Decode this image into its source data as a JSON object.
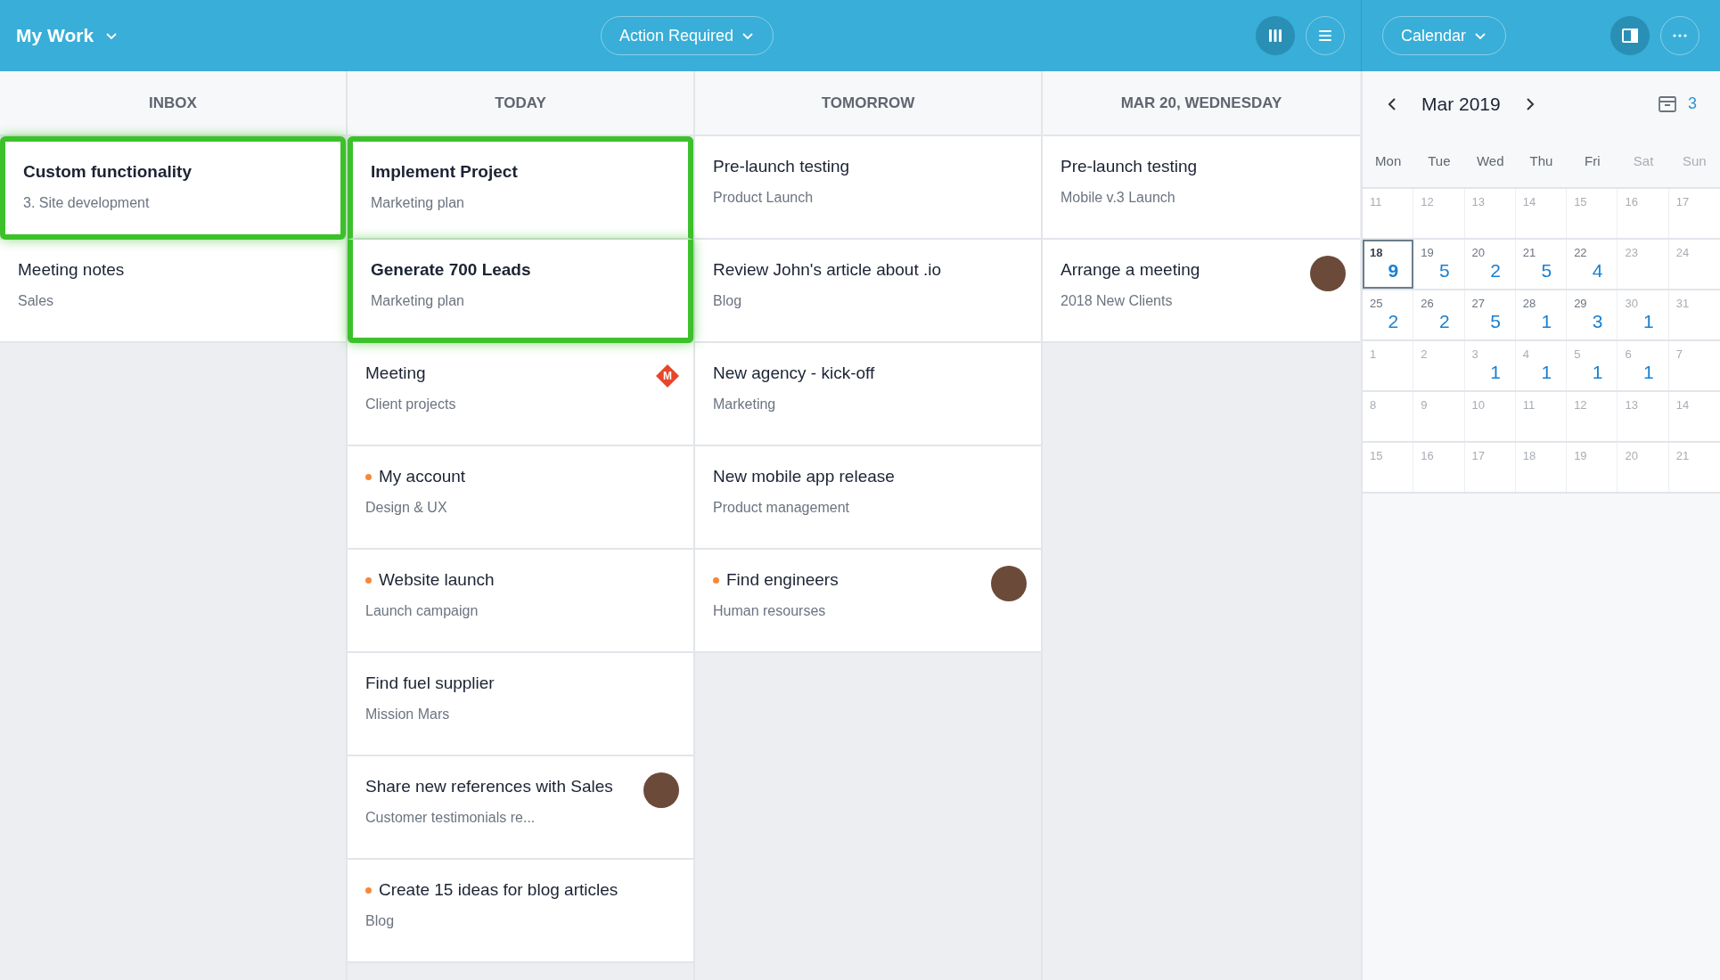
{
  "header": {
    "title": "My Work",
    "filter": "Action Required",
    "views": [
      {
        "kind": "board",
        "selected": true
      },
      {
        "kind": "list",
        "selected": false
      }
    ],
    "calendar_menu": "Calendar",
    "panel_selected": true
  },
  "columns": [
    {
      "title": "INBOX",
      "cards": [
        {
          "title": "Custom functionality",
          "subtitle": "3. Site development",
          "highlighted": true,
          "dot": false
        },
        {
          "title": "Meeting notes",
          "subtitle": "Sales",
          "highlighted": false,
          "dot": false
        }
      ]
    },
    {
      "title": "TODAY",
      "cards": [
        {
          "title": "Implement Project",
          "subtitle": "Marketing plan",
          "highlighted": true,
          "dot": false
        },
        {
          "title": "Generate 700 Leads",
          "subtitle": "Marketing plan",
          "highlighted": true,
          "dot": false
        },
        {
          "title": "Meeting",
          "subtitle": "Client projects",
          "highlighted": false,
          "dot": false,
          "badge": "M"
        },
        {
          "title": "My account",
          "subtitle": "Design & UX",
          "highlighted": false,
          "dot": true
        },
        {
          "title": "Website launch",
          "subtitle": "Launch campaign",
          "highlighted": false,
          "dot": true
        },
        {
          "title": "Find fuel supplier",
          "subtitle": "Mission Mars",
          "highlighted": false,
          "dot": false
        },
        {
          "title": "Share new references with Sales",
          "subtitle": "Customer testimonials re...",
          "highlighted": false,
          "dot": false,
          "avatar": true
        },
        {
          "title": "Create 15 ideas for blog articles",
          "subtitle": "Blog",
          "highlighted": false,
          "dot": true
        }
      ]
    },
    {
      "title": "TOMORROW",
      "cards": [
        {
          "title": "Pre-launch testing",
          "subtitle": "Product Launch",
          "highlighted": false,
          "dot": false
        },
        {
          "title": "Review John's article about .io",
          "subtitle": "Blog",
          "highlighted": false,
          "dot": false
        },
        {
          "title": "New agency - kick-off",
          "subtitle": "Marketing",
          "highlighted": false,
          "dot": false
        },
        {
          "title": "New mobile app release",
          "subtitle": "Product management",
          "highlighted": false,
          "dot": false
        },
        {
          "title": "Find engineers",
          "subtitle": "Human resourses",
          "highlighted": false,
          "dot": true,
          "avatar": true
        }
      ]
    },
    {
      "title": "MAR 20, WEDNESDAY",
      "cards": [
        {
          "title": "Pre-launch testing",
          "subtitle": "Mobile v.3 Launch",
          "highlighted": false,
          "dot": false
        },
        {
          "title": "Arrange a meeting",
          "subtitle": "2018 New Clients",
          "highlighted": false,
          "dot": false,
          "avatar": true
        }
      ]
    }
  ],
  "calendar": {
    "month": "Mar 2019",
    "archive_count": "3",
    "weekdays": [
      {
        "label": "Mon",
        "muted": false
      },
      {
        "label": "Tue",
        "muted": false
      },
      {
        "label": "Wed",
        "muted": false
      },
      {
        "label": "Thu",
        "muted": false
      },
      {
        "label": "Fri",
        "muted": false
      },
      {
        "label": "Sat",
        "muted": true
      },
      {
        "label": "Sun",
        "muted": true
      }
    ],
    "weeks": [
      [
        {
          "day": "11",
          "muted": true,
          "selected": false
        },
        {
          "day": "12",
          "muted": true,
          "selected": false
        },
        {
          "day": "13",
          "muted": true,
          "selected": false
        },
        {
          "day": "14",
          "muted": true,
          "selected": false
        },
        {
          "day": "15",
          "muted": true,
          "selected": false
        },
        {
          "day": "16",
          "muted": true,
          "selected": false
        },
        {
          "day": "17",
          "muted": true,
          "selected": false
        }
      ],
      [
        {
          "day": "18",
          "count": "9",
          "muted": false,
          "selected": true
        },
        {
          "day": "19",
          "count": "5",
          "muted": false,
          "selected": false
        },
        {
          "day": "20",
          "count": "2",
          "muted": false,
          "selected": false
        },
        {
          "day": "21",
          "count": "5",
          "muted": false,
          "selected": false
        },
        {
          "day": "22",
          "count": "4",
          "muted": false,
          "selected": false
        },
        {
          "day": "23",
          "muted": true,
          "selected": false
        },
        {
          "day": "24",
          "muted": true,
          "selected": false
        }
      ],
      [
        {
          "day": "25",
          "count": "2",
          "muted": false,
          "selected": false
        },
        {
          "day": "26",
          "count": "2",
          "muted": false,
          "selected": false
        },
        {
          "day": "27",
          "count": "5",
          "muted": false,
          "selected": false
        },
        {
          "day": "28",
          "count": "1",
          "muted": false,
          "selected": false
        },
        {
          "day": "29",
          "count": "3",
          "muted": false,
          "selected": false
        },
        {
          "day": "30",
          "count": "1",
          "muted": true,
          "selected": false
        },
        {
          "day": "31",
          "muted": true,
          "selected": false
        }
      ],
      [
        {
          "day": "1",
          "muted": true,
          "selected": false
        },
        {
          "day": "2",
          "muted": true,
          "selected": false
        },
        {
          "day": "3",
          "count": "1",
          "muted": true,
          "selected": false
        },
        {
          "day": "4",
          "count": "1",
          "muted": true,
          "selected": false
        },
        {
          "day": "5",
          "count": "1",
          "muted": true,
          "selected": false
        },
        {
          "day": "6",
          "count": "1",
          "muted": true,
          "selected": false
        },
        {
          "day": "7",
          "muted": true,
          "selected": false
        }
      ],
      [
        {
          "day": "8",
          "muted": true,
          "selected": false
        },
        {
          "day": "9",
          "muted": true,
          "selected": false
        },
        {
          "day": "10",
          "muted": true,
          "selected": false
        },
        {
          "day": "11",
          "muted": true,
          "selected": false
        },
        {
          "day": "12",
          "muted": true,
          "selected": false
        },
        {
          "day": "13",
          "muted": true,
          "selected": false
        },
        {
          "day": "14",
          "muted": true,
          "selected": false
        }
      ],
      [
        {
          "day": "15",
          "muted": true,
          "selected": false
        },
        {
          "day": "16",
          "muted": true,
          "selected": false
        },
        {
          "day": "17",
          "muted": true,
          "selected": false
        },
        {
          "day": "18",
          "muted": true,
          "selected": false
        },
        {
          "day": "19",
          "muted": true,
          "selected": false
        },
        {
          "day": "20",
          "muted": true,
          "selected": false
        },
        {
          "day": "21",
          "muted": true,
          "selected": false
        }
      ]
    ]
  }
}
